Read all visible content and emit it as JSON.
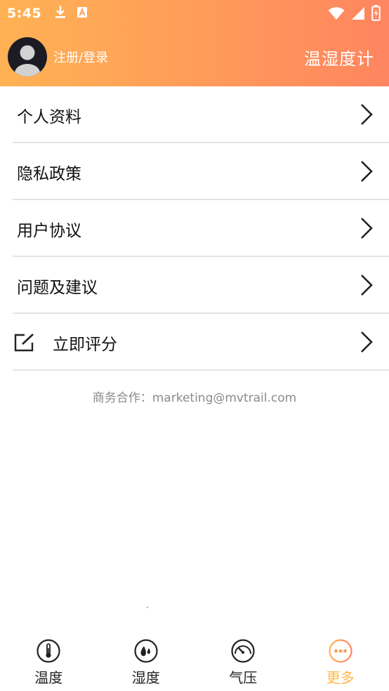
{
  "status_bar": {
    "time": "5:45",
    "left_icons": [
      "download-icon",
      "a-badge-icon"
    ],
    "right_icons": [
      "wifi-icon",
      "signal-icon",
      "battery-icon"
    ]
  },
  "header": {
    "login_text": "注册/登录",
    "app_title": "温湿度计",
    "gradient_colors": [
      "#ffb254",
      "#ff8560"
    ]
  },
  "menu": {
    "items": [
      {
        "label": "个人资料"
      },
      {
        "label": "隐私政策"
      },
      {
        "label": "用户协议"
      },
      {
        "label": "问题及建议"
      },
      {
        "label": "立即评分",
        "icon": "edit-icon"
      }
    ]
  },
  "contact": {
    "text": "商务合作：marketing@mvtrail.com"
  },
  "tabbar": {
    "active_color": "#ffb74a",
    "tabs": [
      {
        "label": "温度",
        "icon": "thermometer-icon"
      },
      {
        "label": "湿度",
        "icon": "droplets-icon"
      },
      {
        "label": "气压",
        "icon": "gauge-icon"
      },
      {
        "label": "更多",
        "icon": "more-icon",
        "active": true
      }
    ]
  }
}
